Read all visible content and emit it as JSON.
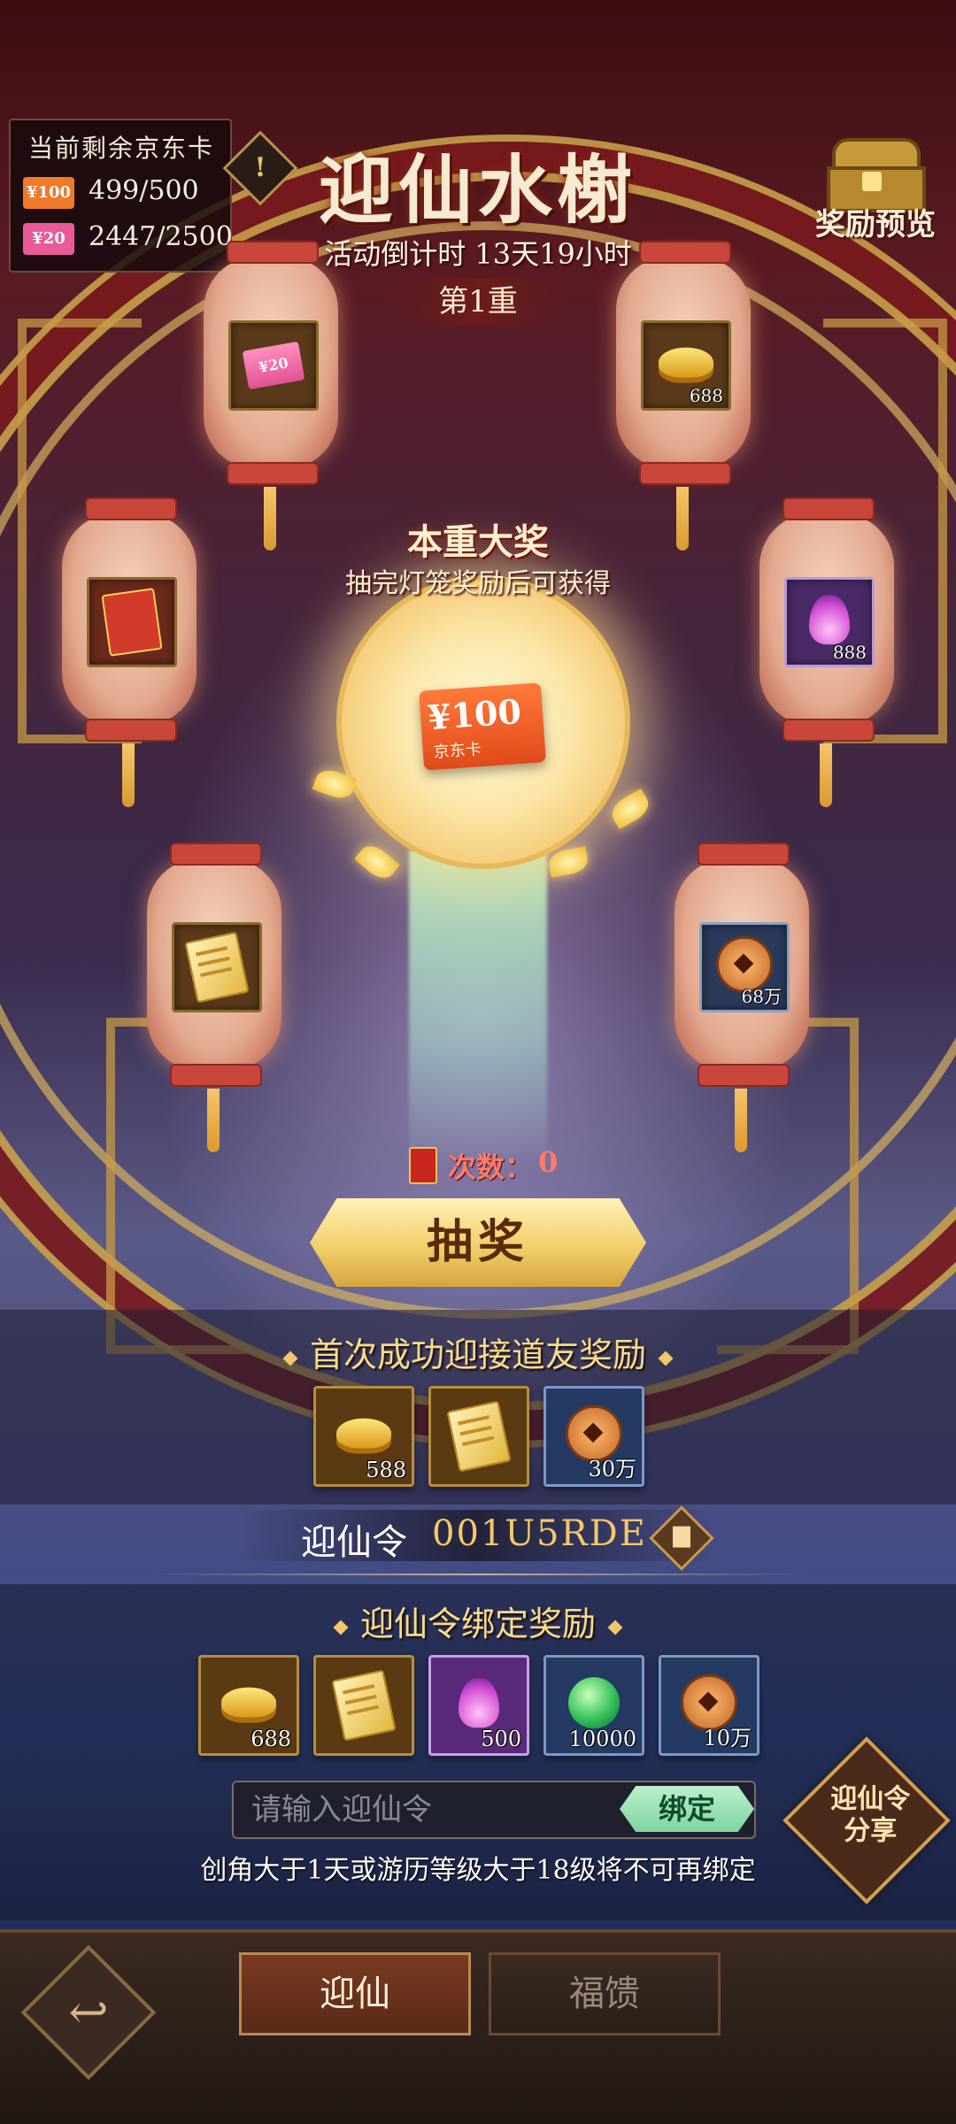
{
  "remaining": {
    "title": "当前剩余京东卡",
    "cards": [
      {
        "badge": "¥100",
        "value": "499/500",
        "color": "#f07a2a"
      },
      {
        "badge": "¥20",
        "value": "2447/2500",
        "color": "#ea5a98"
      }
    ]
  },
  "info_icon": "!",
  "header": {
    "title": "迎仙水榭",
    "countdown": "活动倒计时 13天19小时",
    "tier": "第1重"
  },
  "preview": {
    "label": "奖励预览",
    "icon": "treasure-chest-icon"
  },
  "lanterns": [
    {
      "icon": "jd-card-20-icon",
      "badge": "¥20",
      "qty": ""
    },
    {
      "icon": "gold-ingot-icon",
      "qty": "688"
    },
    {
      "icon": "red-envelope-icon",
      "qty": ""
    },
    {
      "icon": "purple-flame-icon",
      "qty": "888"
    },
    {
      "icon": "golden-ticket-icon",
      "qty": ""
    },
    {
      "icon": "copper-coin-icon",
      "qty": "68万"
    }
  ],
  "grand_prize": {
    "title": "本重大奖",
    "subtitle": "抽完灯笼奖励后可获得",
    "amount": "¥100",
    "brand": "京东卡"
  },
  "draw": {
    "count_label": "次数：",
    "count_value": "0",
    "button_label": "抽奖"
  },
  "first_reward": {
    "title": "首次成功迎接道友奖励",
    "items": [
      {
        "icon": "gold-ingot-icon",
        "qty": "588"
      },
      {
        "icon": "golden-ticket-icon",
        "qty": ""
      },
      {
        "icon": "copper-coin-icon",
        "qty": "30万"
      }
    ]
  },
  "code": {
    "label": "迎仙令",
    "value": "001U5RDE",
    "copy_icon": "copy-icon"
  },
  "bind_reward": {
    "title": "迎仙令绑定奖励",
    "items": [
      {
        "icon": "gold-ingot-icon",
        "qty": "688"
      },
      {
        "icon": "golden-ticket-icon",
        "qty": ""
      },
      {
        "icon": "purple-flame-icon",
        "qty": "500"
      },
      {
        "icon": "green-orb-icon",
        "qty": "10000"
      },
      {
        "icon": "copper-coin-icon",
        "qty": "10万"
      }
    ],
    "input_placeholder": "请输入迎仙令",
    "bind_button": "绑定",
    "hint": "创角大于1天或游历等级大于18级将不可再绑定"
  },
  "share": {
    "line1": "迎仙令",
    "line2": "分享"
  },
  "bottom": {
    "back_icon": "back-arrow-icon",
    "tabs": [
      {
        "label": "迎仙",
        "active": true
      },
      {
        "label": "福馈",
        "active": false
      }
    ]
  }
}
